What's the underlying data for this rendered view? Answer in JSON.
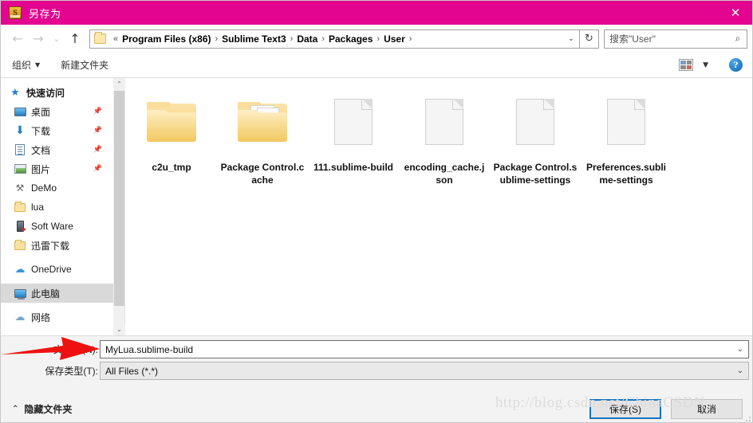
{
  "titlebar": {
    "title": "另存为",
    "icon": "sublime-text-icon",
    "close_label": "✕",
    "background": "#e3058f"
  },
  "navbar": {
    "back_icon": "←",
    "forward_icon": "→",
    "recent_icon": "⌄",
    "up_icon": "↑",
    "breadcrumbs": [
      "«",
      "Program Files (x86)",
      "Sublime Text3",
      "Data",
      "Packages",
      "User"
    ],
    "dropdown_icon": "⌄",
    "refresh_icon": "↻",
    "search_placeholder": "搜索\"User\"",
    "search_icon": "⌕"
  },
  "commandbar": {
    "organize_label": "组织",
    "organize_caret": "▼",
    "new_folder_label": "新建文件夹",
    "view_caret": "▼",
    "help_label": "?"
  },
  "sidebar": {
    "items": [
      {
        "label": "快速访问",
        "icon": "star-pin-icon",
        "kind": "header",
        "pinned": false,
        "selected": false
      },
      {
        "label": "桌面",
        "icon": "desktop-icon",
        "kind": "item",
        "pinned": true,
        "selected": false
      },
      {
        "label": "下载",
        "icon": "download-icon",
        "kind": "item",
        "pinned": true,
        "selected": false
      },
      {
        "label": "文档",
        "icon": "documents-icon",
        "kind": "item",
        "pinned": true,
        "selected": false
      },
      {
        "label": "图片",
        "icon": "pictures-icon",
        "kind": "item",
        "pinned": true,
        "selected": false
      },
      {
        "label": "DeMo",
        "icon": "demo-folder-icon",
        "kind": "item",
        "pinned": false,
        "selected": false
      },
      {
        "label": "lua",
        "icon": "folder-icon",
        "kind": "item",
        "pinned": false,
        "selected": false
      },
      {
        "label": "Soft Ware",
        "icon": "software-icon",
        "kind": "item",
        "pinned": false,
        "selected": false
      },
      {
        "label": "迅雷下载",
        "icon": "folder-icon",
        "kind": "item",
        "pinned": false,
        "selected": false
      },
      {
        "label": "OneDrive",
        "icon": "onedrive-icon",
        "kind": "group",
        "pinned": false,
        "selected": false
      },
      {
        "label": "此电脑",
        "icon": "this-pc-icon",
        "kind": "group",
        "pinned": false,
        "selected": true
      },
      {
        "label": "网络",
        "icon": "network-icon",
        "kind": "group",
        "pinned": false,
        "selected": false
      }
    ],
    "scroll_up_icon": "⌃",
    "scroll_down_icon": "⌄"
  },
  "files": [
    {
      "name": "c2u_tmp",
      "type": "folder"
    },
    {
      "name": "Package Control.cache",
      "type": "folder-docs"
    },
    {
      "name": "111.sublime-build",
      "type": "document"
    },
    {
      "name": "encoding_cache.json",
      "type": "document"
    },
    {
      "name": "Package Control.sublime-settings",
      "type": "document"
    },
    {
      "name": "Preferences.sublime-settings",
      "type": "document"
    }
  ],
  "form": {
    "filename_label": "文件名(N):",
    "filename_value": "MyLua.sublime-build",
    "filetype_label": "保存类型(T):",
    "filetype_value": "All Files (*.*)",
    "dropdown_icon": "⌄"
  },
  "footer": {
    "hide_folders_label": "隐藏文件夹",
    "hide_folders_caret": "⌃",
    "save_label": "保存(S)",
    "cancel_label": "取消"
  },
  "watermark": "http://blog.csdn.net/ChinaCSDN"
}
